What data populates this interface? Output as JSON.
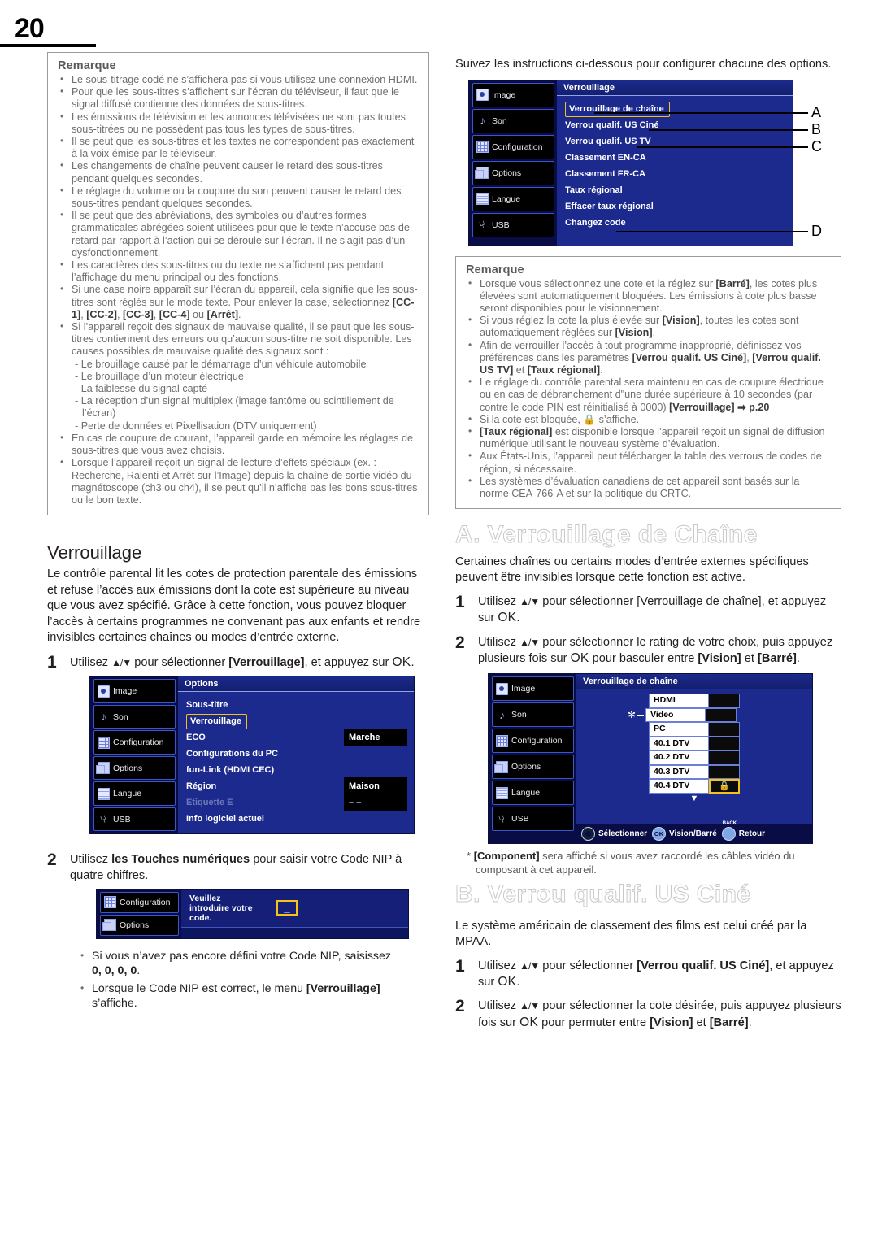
{
  "page": {
    "number": "20"
  },
  "left": {
    "note": {
      "title": "Remarque",
      "items": [
        "Le sous-titrage codé ne s’affichera pas si vous utilisez une connexion HDMI.",
        "Pour que les sous-titres s’affichent sur l’écran du téléviseur, il faut que le signal diffusé contienne des données de sous-titres.",
        "Les émissions de télévision et les annonces télévisées ne sont pas toutes sous-titrées ou ne possèdent pas tous les types de sous-titres.",
        "Il se peut que les sous-titres et les textes ne correspondent pas exactement à la voix émise par le téléviseur.",
        "Les changements de chaîne peuvent causer le retard des sous-titres pendant quelques secondes.",
        "Le réglage du volume ou la coupure du son peuvent causer le retard des sous-titres pendant quelques secondes.",
        "Il se peut que des abréviations, des symboles ou d’autres formes grammaticales abrégées soient utilisées pour que le texte n’accuse pas de retard par rapport à l’action qui se déroule sur l’écran. Il ne s’agit pas d’un dysfonctionnement.",
        "Les caractères des sous-titres ou du texte ne s’affichent pas pendant l’affichage du menu principal ou des fonctions."
      ],
      "cc_item": {
        "pre": "Si une case noire apparaît sur l’écran du appareil, cela signifie que les sous-titres sont réglés sur le mode texte. Pour enlever la case, sélectionnez ",
        "opts": [
          "[CC-1]",
          "[CC-2]",
          "[CC-3]",
          "[CC-4]"
        ],
        "mid": " ou ",
        "last": "[Arrêt]",
        "post": "."
      },
      "signal_item": {
        "lead": "Si l’appareil reçoit des signaux de mauvaise qualité, il se peut que les sous-titres contiennent des erreurs ou qu’aucun sous-titre ne soit disponible. Les causes possibles de mauvaise qualité des signaux sont :",
        "subs": [
          "- Le brouillage causé par le démarrage d’un véhicule automobile",
          "- Le brouillage d’un moteur électrique",
          "- La faiblesse du signal capté",
          "- La réception d’un signal multiplex (image fantôme ou scintillement de l’écran)",
          "- Perte de données et Pixellisation (DTV uniquement)"
        ]
      },
      "tail_items": [
        "En cas de coupure de courant, l’appareil garde en mémoire les réglages de sous-titres que vous avez choisis.",
        "Lorsque l’appareil reçoit un signal de lecture d’effets spéciaux (ex. : Recherche, Ralenti et Arrêt sur l’Image) depuis la chaîne de sortie vidéo du magnétoscope (ch3 ou ch4), il se peut qu’il n’affiche pas les bons sous-titres ou le bon texte."
      ]
    },
    "section": {
      "heading": "Verrouillage",
      "paragraph": "Le contrôle parental lit les cotes de protection parentale des émissions et refuse l’accès aux émissions dont la cote est supérieure au niveau que vous avez spécifié. Grâce à cette fonction, vous pouvez bloquer l’accès à certains programmes ne convenant pas aux enfants et rendre invisibles certaines chaînes ou modes d’entrée externe."
    },
    "step1": {
      "num": "1",
      "pre": "Utilisez ",
      "arrows": "▲/▼",
      "mid": " pour sélectionner ",
      "target": "[Verrouillage]",
      "post": ", et appuyez sur ",
      "ok": "OK",
      "end": "."
    },
    "step2": {
      "num": "2",
      "pre": "Utilisez ",
      "bold": "les Touches numériques",
      "post": " pour saisir votre Code NIP à quatre chiffres."
    },
    "step2_notes": [
      {
        "pre": "Si vous n’avez pas encore défini votre Code NIP, saisissez ",
        "bold": "0, 0, 0, 0",
        "post": "."
      },
      {
        "pre": "Lorsque le Code NIP est correct, le menu ",
        "bold": "[Verrouillage]",
        "post": " s’affiche."
      }
    ],
    "osd_options": {
      "title": "Options",
      "sidebar": [
        {
          "label": "Image",
          "icon": "image-icon"
        },
        {
          "label": "Son",
          "icon": "note-icon"
        },
        {
          "label": "Configuration",
          "icon": "grid-icon"
        },
        {
          "label": "Options",
          "icon": "layers-icon"
        },
        {
          "label": "Langue",
          "icon": "pencil-icon"
        },
        {
          "label": "USB",
          "icon": "usb-icon"
        }
      ],
      "rows": [
        {
          "label": "Sous-titre",
          "value": "",
          "selected": false,
          "dim": false
        },
        {
          "label": "Verrouillage",
          "value": "",
          "selected": true,
          "dim": false
        },
        {
          "label": "ECO",
          "value": "Marche",
          "selected": false,
          "dim": false
        },
        {
          "label": "Configurations du PC",
          "value": "",
          "selected": false,
          "dim": false
        },
        {
          "label": "fun-Link (HDMI CEC)",
          "value": "",
          "selected": false,
          "dim": false
        },
        {
          "label": "Région",
          "value": "Maison",
          "selected": false,
          "dim": false
        },
        {
          "label": "Etiquette E",
          "value": "– –",
          "selected": false,
          "dim": true
        },
        {
          "label": "Info logiciel actuel",
          "value": "",
          "selected": false,
          "dim": false
        }
      ]
    },
    "osd_pin": {
      "sidebar": [
        {
          "label": "Configuration",
          "icon": "grid-icon"
        },
        {
          "label": "Options",
          "icon": "layers-icon"
        }
      ],
      "prompt": "Veuillez introduire votre code.",
      "slots": [
        "_",
        "_",
        "_",
        "_"
      ],
      "active_slot": 0
    }
  },
  "right": {
    "intro": "Suivez les instructions ci-dessous pour configurer chacune des options.",
    "osd_verrouillage": {
      "title": "Verrouillage",
      "sidebar": [
        {
          "label": "Image",
          "icon": "image-icon"
        },
        {
          "label": "Son",
          "icon": "note-icon"
        },
        {
          "label": "Configuration",
          "icon": "grid-icon"
        },
        {
          "label": "Options",
          "icon": "layers-icon"
        },
        {
          "label": "Langue",
          "icon": "pencil-icon"
        },
        {
          "label": "USB",
          "icon": "usb-icon"
        }
      ],
      "rows": [
        {
          "label": "Verrouillage de chaîne",
          "selected": true
        },
        {
          "label": "Verrou qualif. US Ciné",
          "selected": false
        },
        {
          "label": "Verrou qualif. US TV",
          "selected": false
        },
        {
          "label": "Classement EN-CA",
          "selected": false
        },
        {
          "label": "Classement FR-CA",
          "selected": false
        },
        {
          "label": "Taux régional",
          "selected": false
        },
        {
          "label": "Effacer taux régional",
          "selected": false
        },
        {
          "label": "Changez code",
          "selected": false
        }
      ],
      "callouts": [
        "A",
        "B",
        "C",
        "D"
      ]
    },
    "note": {
      "title": "Remarque",
      "items": [
        {
          "segs": [
            {
              "t": "Lorsque vous sélectionnez une cote et la réglez sur ",
              "b": false
            },
            {
              "t": "[Barré]",
              "b": true
            },
            {
              "t": ", les cotes plus élevées sont automatiquement bloquées. Les émissions à cote plus basse seront disponibles pour le visionnement.",
              "b": false
            }
          ]
        },
        {
          "segs": [
            {
              "t": "Si vous réglez la cote la plus élevée sur ",
              "b": false
            },
            {
              "t": "[Vision]",
              "b": true
            },
            {
              "t": ", toutes les cotes sont automatiquement réglées sur ",
              "b": false
            },
            {
              "t": "[Vision]",
              "b": true
            },
            {
              "t": ".",
              "b": false
            }
          ]
        },
        {
          "segs": [
            {
              "t": "Afin de verrouiller l’accès à tout programme inapproprié, définissez vos préférences dans les paramètres ",
              "b": false
            },
            {
              "t": "[Verrou qualif. US Ciné]",
              "b": true
            },
            {
              "t": ", ",
              "b": false
            },
            {
              "t": "[Verrou qualif. US TV]",
              "b": true
            },
            {
              "t": " et ",
              "b": false
            },
            {
              "t": "[Taux régional]",
              "b": true
            },
            {
              "t": ".",
              "b": false
            }
          ]
        },
        {
          "segs": [
            {
              "t": "Le réglage du contrôle parental sera maintenu en cas de coupure électrique ou en cas de débranchement d\"une durée supérieure à 10 secondes (par contre le code PIN est réinitialisé à 0000) ",
              "b": false
            },
            {
              "t": "[Verrouillage] ➡ p.20",
              "b": true
            }
          ]
        },
        {
          "segs": [
            {
              "t": "Si la cote est bloquée, ",
              "b": false
            },
            {
              "t": "🔒",
              "b": false
            },
            {
              "t": " s’affiche.",
              "b": false
            }
          ]
        },
        {
          "segs": [
            {
              "t": "[Taux régional]",
              "b": true
            },
            {
              "t": " est disponible lorsque l’appareil reçoit un signal de diffusion numérique utilisant le nouveau système d’évaluation.",
              "b": false
            }
          ]
        },
        {
          "segs": [
            {
              "t": "Aux États-Unis, l’appareil peut télécharger la table des verrous de codes de région, si nécessaire.",
              "b": false
            }
          ]
        },
        {
          "segs": [
            {
              "t": "Les systèmes d’évaluation canadiens de cet appareil sont basés sur la norme CEA-766-A et sur la politique du CRTC.",
              "b": false
            }
          ]
        }
      ]
    },
    "sectionA": {
      "heading": "A. Verrouillage de Chaîne",
      "paragraph": "Certaines chaînes ou certains modes d’entrée externes spécifiques peuvent être invisibles lorsque cette fonction est active.",
      "step1": {
        "num": "1",
        "pre": "Utilisez ",
        "arrows": "▲/▼",
        "mid": " pour sélectionner ",
        "target": "[Verrouillage de chaîne]",
        "post": ", et appuyez sur ",
        "ok": "OK",
        "end": "."
      },
      "step2": {
        "num": "2",
        "pre": "Utilisez ",
        "arrows": "▲/▼",
        "mid": " pour sélectionner le rating de votre choix, puis appuyez plusieurs fois sur ",
        "ok": "OK",
        "post": " pour basculer entre ",
        "t1": "[Vision]",
        "conj": " et ",
        "t2": "[Barré]",
        "end": "."
      },
      "footnote": {
        "star": "*",
        "bold": "[Component]",
        "rest": " sera affiché si vous avez raccordé les câbles vidéo du composant à cet appareil."
      }
    },
    "osd_chanlock": {
      "title": "Verrouillage de chaîne",
      "sidebar": [
        {
          "label": "Image",
          "icon": "image-icon"
        },
        {
          "label": "Son",
          "icon": "note-icon"
        },
        {
          "label": "Configuration",
          "icon": "grid-icon"
        },
        {
          "label": "Options",
          "icon": "layers-icon"
        },
        {
          "label": "Langue",
          "icon": "pencil-icon"
        },
        {
          "label": "USB",
          "icon": "usb-icon"
        }
      ],
      "channels": [
        {
          "name": "HDMI",
          "locked": false,
          "selected": false,
          "star": false
        },
        {
          "name": "Video",
          "locked": false,
          "selected": false,
          "star": true
        },
        {
          "name": "PC",
          "locked": false,
          "selected": false,
          "star": false
        },
        {
          "name": "40.1 DTV",
          "locked": false,
          "selected": false,
          "star": false
        },
        {
          "name": "40.2 DTV",
          "locked": false,
          "selected": false,
          "star": false
        },
        {
          "name": "40.3 DTV",
          "locked": false,
          "selected": false,
          "star": false
        },
        {
          "name": "40.4 DTV",
          "locked": true,
          "selected": true,
          "star": false
        }
      ],
      "actions": [
        {
          "icon": "dpad-icon",
          "label": "Sélectionner"
        },
        {
          "icon": "ok-icon",
          "label": "Vision/Barré"
        },
        {
          "icon": "back-icon",
          "label": "Retour"
        }
      ],
      "ok_glyph": "OK",
      "back_glyph": "BACK"
    },
    "sectionB": {
      "heading": "B. Verrou qualif. US Ciné",
      "paragraph": "Le système américain de classement des films est celui créé par la MPAA.",
      "step1": {
        "num": "1",
        "pre": "Utilisez ",
        "arrows": "▲/▼",
        "mid": " pour sélectionner ",
        "target": "[Verrou qualif. US Ciné]",
        "post": ", et appuyez sur ",
        "ok": "OK",
        "end": "."
      },
      "step2": {
        "num": "2",
        "pre": "Utilisez ",
        "arrows": "▲/▼",
        "mid": " pour sélectionner la cote désirée, puis appuyez plusieurs fois sur ",
        "ok": "OK",
        "post": " pour permuter entre ",
        "t1": "[Vision]",
        "conj": " et ",
        "t2": "[Barré]",
        "end": "."
      }
    }
  },
  "colors": {
    "osd_bg": "#1c2a8e",
    "osd_side": "#0a0d45",
    "highlight": "#f5c21a",
    "note_text": "#6d6e71"
  }
}
